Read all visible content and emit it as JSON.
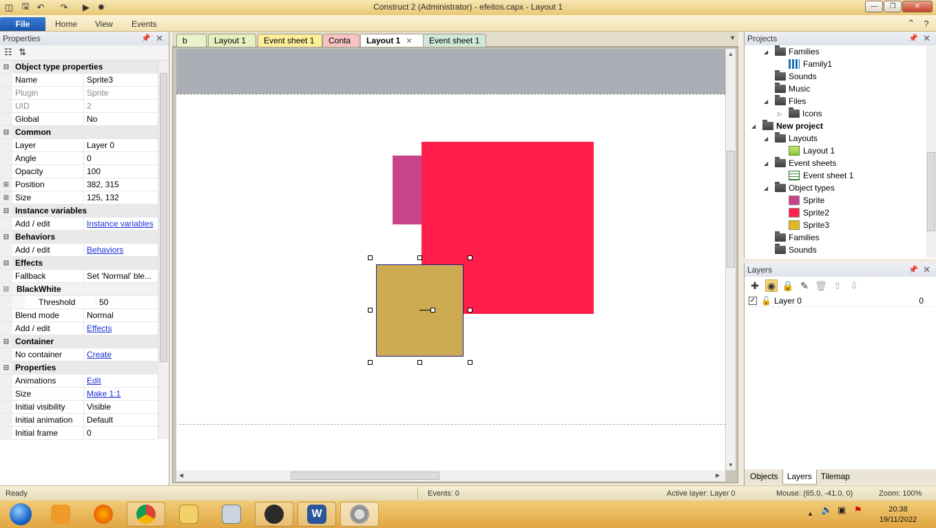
{
  "window": {
    "title": "Construct 2 (Administrator) - efeitos.capx - Layout 1"
  },
  "ribbon": {
    "tabs": [
      "File",
      "Home",
      "View",
      "Events"
    ]
  },
  "properties_panel": {
    "title": "Properties",
    "rows": [
      {
        "type": "cat",
        "label": "Object type properties"
      },
      {
        "type": "prop",
        "key": "Name",
        "value": "Sprite3"
      },
      {
        "type": "prop",
        "key": "Plugin",
        "value": "Sprite",
        "gray": true
      },
      {
        "type": "prop",
        "key": "UID",
        "value": "2",
        "gray": true
      },
      {
        "type": "prop",
        "key": "Global",
        "value": "No"
      },
      {
        "type": "cat",
        "label": "Common"
      },
      {
        "type": "prop",
        "key": "Layer",
        "value": "Layer 0"
      },
      {
        "type": "prop",
        "key": "Angle",
        "value": "0"
      },
      {
        "type": "prop",
        "key": "Opacity",
        "value": "100"
      },
      {
        "type": "prop",
        "key": "Position",
        "value": "382, 315",
        "expand": true
      },
      {
        "type": "prop",
        "key": "Size",
        "value": "125, 132",
        "expand": true
      },
      {
        "type": "cat",
        "label": "Instance variables"
      },
      {
        "type": "prop",
        "key": "Add / edit",
        "value": "Instance variables",
        "link": true
      },
      {
        "type": "cat",
        "label": "Behaviors"
      },
      {
        "type": "prop",
        "key": "Add / edit",
        "value": "Behaviors",
        "link": true
      },
      {
        "type": "cat",
        "label": "Effects"
      },
      {
        "type": "prop",
        "key": "Fallback",
        "value": "Set 'Normal' ble..."
      },
      {
        "type": "subcat",
        "label": "BlackWhite"
      },
      {
        "type": "sub",
        "key": "Threshold",
        "value": "50"
      },
      {
        "type": "prop",
        "key": "Blend mode",
        "value": "Normal"
      },
      {
        "type": "prop",
        "key": "Add / edit",
        "value": "Effects",
        "link": true
      },
      {
        "type": "cat",
        "label": "Container"
      },
      {
        "type": "prop",
        "key": "No container",
        "value": "Create",
        "link": true
      },
      {
        "type": "cat",
        "label": "Properties"
      },
      {
        "type": "prop",
        "key": "Animations",
        "value": "Edit",
        "link": true
      },
      {
        "type": "prop",
        "key": "Size",
        "value": "Make 1:1",
        "link": true
      },
      {
        "type": "prop",
        "key": "Initial visibility",
        "value": "Visible"
      },
      {
        "type": "prop",
        "key": "Initial animation",
        "value": "Default"
      },
      {
        "type": "prop",
        "key": "Initial frame",
        "value": "0"
      }
    ]
  },
  "doc_tabs": [
    {
      "label": "b",
      "color": "#e9f3c9"
    },
    {
      "label": "Layout 1",
      "color": "#e6f0c0"
    },
    {
      "label": "Event sheet 1",
      "color": "#fbef9a"
    },
    {
      "label": "Conta",
      "color": "#f7c3c3"
    },
    {
      "label": "Layout 1",
      "color": "#ffffff",
      "active": true,
      "close": "✕"
    },
    {
      "label": "Event sheet 1",
      "color": "#cfe8d8"
    }
  ],
  "sprites": [
    {
      "name": "Sprite",
      "color": "#c8448a"
    },
    {
      "name": "Sprite2",
      "color": "#ff1f4a"
    },
    {
      "name": "Sprite3",
      "color": "#ccab52"
    }
  ],
  "projects_panel": {
    "title": "Projects",
    "items": [
      {
        "label": "Families",
        "icon": "folder",
        "expand": "◢"
      },
      {
        "label": "Family1",
        "icon": "family"
      },
      {
        "label": "Sounds",
        "icon": "folder"
      },
      {
        "label": "Music",
        "icon": "folder"
      },
      {
        "label": "Files",
        "icon": "folder",
        "expand": "◢"
      },
      {
        "label": "Icons",
        "icon": "folder",
        "expand": "▷"
      },
      {
        "label": "New project",
        "icon": "folder",
        "expand": "◢",
        "bold": true
      },
      {
        "label": "Layouts",
        "icon": "folder",
        "expand": "◢"
      },
      {
        "label": "Layout 1",
        "icon": "layout"
      },
      {
        "label": "Event sheets",
        "icon": "folder",
        "expand": "◢"
      },
      {
        "label": "Event sheet 1",
        "icon": "eventsheet"
      },
      {
        "label": "Object types",
        "icon": "folder",
        "expand": "◢"
      },
      {
        "label": "Sprite",
        "icon": "swatch",
        "color": "#c8448a"
      },
      {
        "label": "Sprite2",
        "icon": "swatch",
        "color": "#ff1f4a"
      },
      {
        "label": "Sprite3",
        "icon": "swatch",
        "color": "#e2b81f"
      },
      {
        "label": "Families",
        "icon": "folder"
      },
      {
        "label": "Sounds",
        "icon": "folder"
      }
    ]
  },
  "layers_panel": {
    "title": "Layers",
    "layers": [
      {
        "name": "Layer 0",
        "index": "0",
        "checked": "✓"
      }
    ],
    "bottom_tabs": [
      "Objects",
      "Layers",
      "Tilemap"
    ]
  },
  "statusbar": {
    "ready": "Ready",
    "events": "Events: 0",
    "active_layer": "Active layer: Layer 0",
    "mouse": "Mouse: (65.0, -41.0, 0)",
    "zoom": "Zoom: 100%"
  },
  "clock": {
    "time": "20:38",
    "date": "19/11/2022"
  }
}
